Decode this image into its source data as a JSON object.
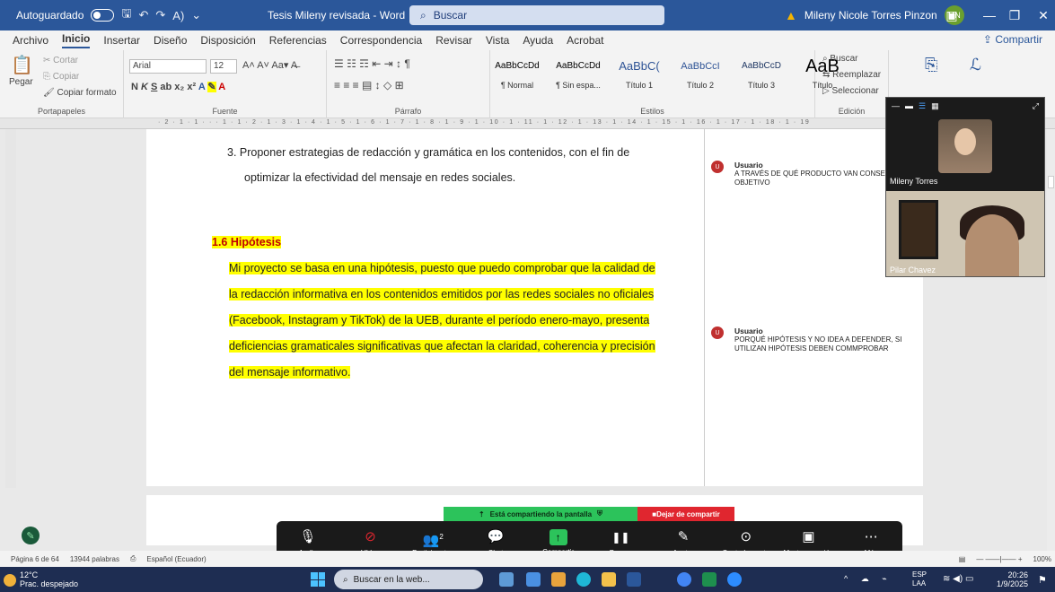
{
  "titlebar": {
    "autosave": "Autoguardado",
    "document_title": "Tesis Mileny revisada - Word",
    "search": "Buscar",
    "user": "Mileny Nicole Torres Pinzon",
    "user_initials": "MN"
  },
  "menu": {
    "tabs": [
      "Archivo",
      "Inicio",
      "Insertar",
      "Diseño",
      "Disposición",
      "Referencias",
      "Correspondencia",
      "Revisar",
      "Vista",
      "Ayuda",
      "Acrobat"
    ],
    "share": "Compartir"
  },
  "ribbon": {
    "clipboard": {
      "paste": "Pegar",
      "cut": "Cortar",
      "copy": "Copiar",
      "format_painter": "Copiar formato",
      "label": "Portapapeles"
    },
    "font": {
      "name": "Arial",
      "size": "12",
      "label": "Fuente"
    },
    "paragraph": {
      "label": "Párrafo"
    },
    "styles": {
      "items": [
        {
          "preview": "AaBbCcDd",
          "name": "¶ Normal"
        },
        {
          "preview": "AaBbCcDd",
          "name": "¶ Sin espa..."
        },
        {
          "preview": "AaBbC(",
          "name": "Título 1"
        },
        {
          "preview": "AaBbCcI",
          "name": "Título 2"
        },
        {
          "preview": "AaBbCcD",
          "name": "Título 3"
        },
        {
          "preview": "AaB",
          "name": "Título"
        }
      ],
      "label": "Estilos"
    },
    "editing": {
      "find": "Buscar",
      "replace": "Reemplazar",
      "select": "Seleccionar",
      "label": "Edición"
    }
  },
  "ruler": {
    "numbers": "· 2 · 1 · 1 · · · 1 · 1 · 2 · 1 · 3 · 1 · 4 · 1 · 5 · 1 · 6 · 1 · 7 · 1 · 8 · 1 · 9 · 1 · 10 · 1 · 11 · 1 · 12 · 1 · 13 · 1 · 14 · 1 · 15 · 1 · 16 · 1 · 17 · 1 · 18 · 1 · 19"
  },
  "document": {
    "item3_line1": "3.  Proponer estrategias de redacción y gramática en los contenidos, con el fin de",
    "item3_line2": "optimizar la efectividad del mensaje en redes sociales.",
    "heading": "1.6 Hipótesis",
    "para_lines": [
      "Mi proyecto se basa en una hipótesis, puesto que puedo comprobar que la calidad de",
      "la redacción informativa en los contenidos emitidos por las redes sociales no oficiales",
      "(Facebook, Instagram y TikTok) de la UEB, durante el período enero-mayo, presenta",
      "deficiencias gramaticales significativas que afectan la claridad, coherencia y precisión",
      "del mensaje informativo."
    ]
  },
  "comments": [
    {
      "initial": "U",
      "author": "Usuario",
      "text": "A TRAVÉS DE QUÉ PRODUCTO VAN CONSEG... OBJETIVO"
    },
    {
      "initial": "U",
      "author": "Usuario",
      "text": "PORQUÉ HIPÓTESIS Y NO IDEA A DEFENDER, SI UTILIZAN HIPÓTESIS DEBEN COMMPROBAR"
    }
  ],
  "zoom": {
    "participant1": "Mileny Torres",
    "participant2": "Pilar Chavez",
    "sharing_banner": "Está compartiendo la pantalla",
    "stop_share": "Dejar de compartir",
    "participants_count": "2",
    "toolbar": [
      {
        "icon": "microphone-icon",
        "glyph": "🎙",
        "label": "Audio"
      },
      {
        "icon": "video-off-icon",
        "glyph": "⊘",
        "label": "Vídeo"
      },
      {
        "icon": "participants-icon",
        "glyph": "👥",
        "label": "Participantes"
      },
      {
        "icon": "chat-icon",
        "glyph": "💬",
        "label": "Chat"
      },
      {
        "icon": "share-icon",
        "glyph": "↑",
        "label": "Compartir"
      },
      {
        "icon": "pause-icon",
        "glyph": "❚❚",
        "label": "Pausar"
      },
      {
        "icon": "annotate-icon",
        "glyph": "✎",
        "label": "Anotar"
      },
      {
        "icon": "remote-control-icon",
        "glyph": "⊙",
        "label": "Control remoto"
      },
      {
        "icon": "show-meeting-icon",
        "glyph": "▣",
        "label": "Mostrar reunión"
      },
      {
        "icon": "more-icon",
        "glyph": "⋯",
        "label": "Más"
      }
    ]
  },
  "statusbar": {
    "page": "Página 6 de 64",
    "words": "13944 palabras",
    "language": "Español (Ecuador)",
    "zoom": "100%"
  },
  "taskbar": {
    "temp": "12°C",
    "weather": "Prac. despejado",
    "search": "Buscar en la web...",
    "lang1": "ESP",
    "lang2": "LAA",
    "time": "20:26",
    "date": "1/9/2025"
  },
  "colors": {
    "word_blue": "#2b579a",
    "highlight": "#ffff00",
    "heading_red": "#c00000",
    "zoom_green": "#2cc35b",
    "zoom_red": "#e0262f"
  }
}
